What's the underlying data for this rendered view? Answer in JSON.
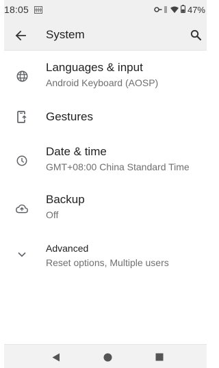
{
  "status_bar": {
    "time": "18:05",
    "battery": "47%",
    "icons": [
      "notification-icon",
      "vpn-key-icon",
      "data-arrows-icon",
      "wifi-icon",
      "battery-icon"
    ]
  },
  "app_bar": {
    "title": "System",
    "back_icon": "arrow-back-icon",
    "search_icon": "search-icon"
  },
  "items": [
    {
      "title": "Languages & input",
      "subtitle": "Android Keyboard (AOSP)",
      "icon": "globe-icon"
    },
    {
      "title": "Gestures",
      "subtitle": "",
      "icon": "phone-gesture-icon"
    },
    {
      "title": "Date & time",
      "subtitle": "GMT+08:00 China Standard Time",
      "icon": "clock-icon"
    },
    {
      "title": "Backup",
      "subtitle": "Off",
      "icon": "cloud-upload-icon"
    },
    {
      "title": "Advanced",
      "subtitle": "Reset options, Multiple users",
      "icon": "chevron-down-icon"
    }
  ],
  "nav_bar": {
    "icons": [
      "back-triangle-icon",
      "home-circle-icon",
      "recents-square-icon"
    ]
  },
  "colors": {
    "bar_background": "#f0f0f0",
    "title_text": "#212121",
    "subtitle_text": "#6f6f6f",
    "icon": "#5f6368"
  }
}
